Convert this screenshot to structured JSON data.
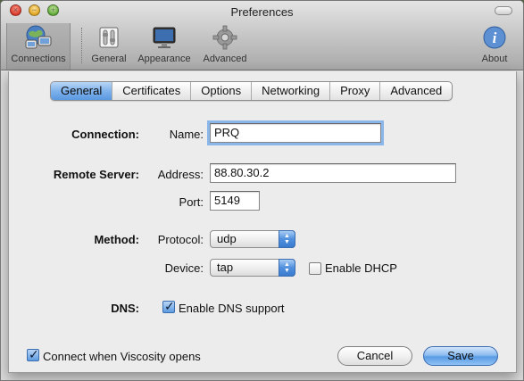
{
  "window": {
    "title": "Preferences"
  },
  "toolbar": {
    "items": [
      {
        "label": "Connections",
        "icon": "connections-globe-icon"
      },
      {
        "label": "General",
        "icon": "general-switches-icon"
      },
      {
        "label": "Appearance",
        "icon": "appearance-monitor-icon"
      },
      {
        "label": "Advanced",
        "icon": "advanced-gear-icon"
      },
      {
        "label": "About",
        "icon": "about-info-icon"
      }
    ]
  },
  "tabs": [
    "General",
    "Certificates",
    "Options",
    "Networking",
    "Proxy",
    "Advanced"
  ],
  "form": {
    "connection_label": "Connection:",
    "name_label": "Name:",
    "name_value": "PRQ",
    "remote_server_label": "Remote Server:",
    "address_label": "Address:",
    "address_value": "88.80.30.2",
    "port_label": "Port:",
    "port_value": "5149",
    "method_label": "Method:",
    "protocol_label": "Protocol:",
    "protocol_value": "udp",
    "device_label": "Device:",
    "device_value": "tap",
    "enable_dhcp_label": "Enable DHCP",
    "enable_dhcp_checked": false,
    "dns_label": "DNS:",
    "enable_dns_label": "Enable DNS support",
    "enable_dns_checked": true
  },
  "footer": {
    "connect_on_open_label": "Connect when Viscosity opens",
    "connect_on_open_checked": true,
    "cancel_label": "Cancel",
    "save_label": "Save"
  },
  "colors": {
    "accent": "#5a98e0",
    "focus_ring": "#8ab6ea"
  }
}
